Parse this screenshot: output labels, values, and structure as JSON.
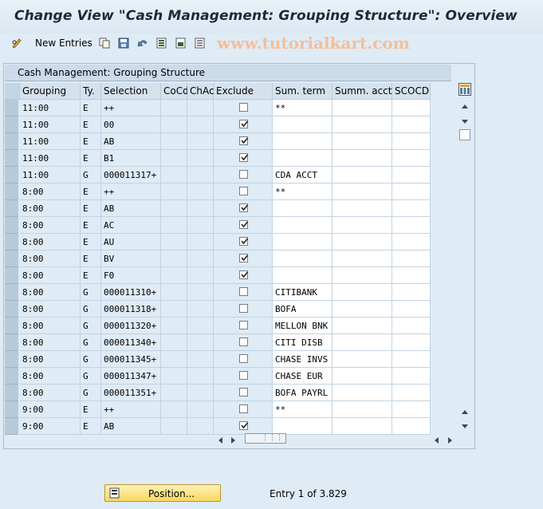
{
  "window": {
    "title": "Change View \"Cash Management: Grouping Structure\": Overview"
  },
  "toolbar": {
    "new_entries_label": "New Entries",
    "watermark": "www.tutorialkart.com"
  },
  "table": {
    "title": "Cash Management: Grouping Structure",
    "columns": [
      "Grouping",
      "Ty.",
      "Selection",
      "CoCd",
      "ChAc",
      "Exclude",
      "Sum. term",
      "Summ. acct",
      "SCOCD"
    ],
    "rows": [
      {
        "grouping": "11:00",
        "type": "E",
        "selection": "++",
        "exclude": false,
        "sum_term": "**"
      },
      {
        "grouping": "11:00",
        "type": "E",
        "selection": "00",
        "exclude": true,
        "sum_term": ""
      },
      {
        "grouping": "11:00",
        "type": "E",
        "selection": "AB",
        "exclude": true,
        "sum_term": ""
      },
      {
        "grouping": "11:00",
        "type": "E",
        "selection": "B1",
        "exclude": true,
        "sum_term": ""
      },
      {
        "grouping": "11:00",
        "type": "G",
        "selection": "000011317+",
        "exclude": false,
        "sum_term": "CDA ACCT"
      },
      {
        "grouping": "8:00",
        "type": "E",
        "selection": "++",
        "exclude": false,
        "sum_term": "**"
      },
      {
        "grouping": "8:00",
        "type": "E",
        "selection": "AB",
        "exclude": true,
        "sum_term": ""
      },
      {
        "grouping": "8:00",
        "type": "E",
        "selection": "AC",
        "exclude": true,
        "sum_term": ""
      },
      {
        "grouping": "8:00",
        "type": "E",
        "selection": "AU",
        "exclude": true,
        "sum_term": ""
      },
      {
        "grouping": "8:00",
        "type": "E",
        "selection": "BV",
        "exclude": true,
        "sum_term": ""
      },
      {
        "grouping": "8:00",
        "type": "E",
        "selection": "F0",
        "exclude": true,
        "sum_term": ""
      },
      {
        "grouping": "8:00",
        "type": "G",
        "selection": "000011310+",
        "exclude": false,
        "sum_term": "CITIBANK"
      },
      {
        "grouping": "8:00",
        "type": "G",
        "selection": "000011318+",
        "exclude": false,
        "sum_term": "BOFA"
      },
      {
        "grouping": "8:00",
        "type": "G",
        "selection": "000011320+",
        "exclude": false,
        "sum_term": "MELLON BNK"
      },
      {
        "grouping": "8:00",
        "type": "G",
        "selection": "000011340+",
        "exclude": false,
        "sum_term": "CITI DISB"
      },
      {
        "grouping": "8:00",
        "type": "G",
        "selection": "000011345+",
        "exclude": false,
        "sum_term": "CHASE INVS"
      },
      {
        "grouping": "8:00",
        "type": "G",
        "selection": "000011347+",
        "exclude": false,
        "sum_term": "CHASE EUR"
      },
      {
        "grouping": "8:00",
        "type": "G",
        "selection": "000011351+",
        "exclude": false,
        "sum_term": "BOFA PAYRL"
      },
      {
        "grouping": "9:00",
        "type": "E",
        "selection": "++",
        "exclude": false,
        "sum_term": "**"
      },
      {
        "grouping": "9:00",
        "type": "E",
        "selection": "AB",
        "exclude": true,
        "sum_term": ""
      }
    ]
  },
  "footer": {
    "position_label": "Position...",
    "entry_text": "Entry 1 of 3.829"
  },
  "icons": [
    "pencil-glasses-icon",
    "copy-icon",
    "save-icon",
    "undo-icon",
    "select-all-icon",
    "select-block-icon",
    "deselect-icon",
    "column-settings-icon",
    "position-icon"
  ],
  "colors": {
    "background": "#dfebf5",
    "cell_editable": "#ffffff",
    "button": "#f7d85f"
  }
}
